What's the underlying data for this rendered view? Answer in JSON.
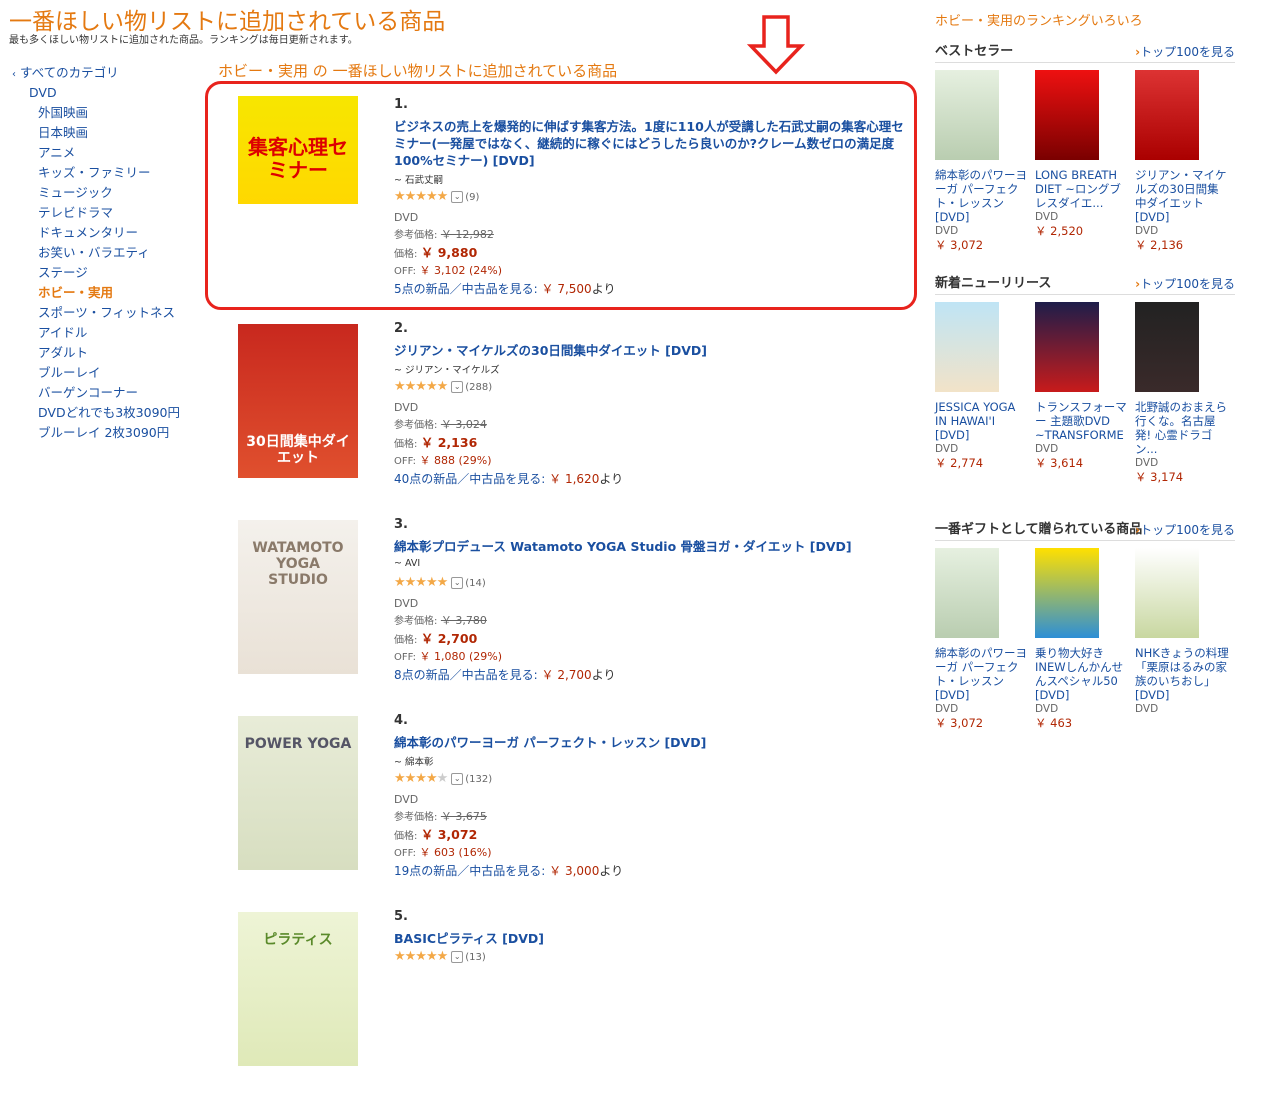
{
  "page": {
    "title": "一番ほしい物リストに追加されている商品",
    "subtitle": "最も多くほしい物リストに追加された商品。ランキングは毎日更新されます。"
  },
  "nav": {
    "all": "すべてのカテゴリ",
    "parent": "DVD",
    "items": [
      "外国映画",
      "日本映画",
      "アニメ",
      "キッズ・ファミリー",
      "ミュージック",
      "テレビドラマ",
      "ドキュメンタリー",
      "お笑い・バラエティ",
      "ステージ",
      "ホビー・実用",
      "スポーツ・フィットネス",
      "アイドル",
      "アダルト",
      "ブルーレイ",
      "バーゲンコーナー",
      "DVDどれでも3枚3090円",
      "ブルーレイ 2枚3090円"
    ],
    "active": "ホビー・実用"
  },
  "list": {
    "heading_category": "ホビー・実用",
    "heading_rest": "の 一番ほしい物リストに追加されている商品",
    "labels": {
      "list_price": "参考価格:",
      "price": "価格:",
      "off": "OFF:",
      "format": "DVD"
    },
    "products": [
      {
        "rank": "1.",
        "title": "ビジネスの売上を爆発的に伸ばす集客方法。1度に110人が受講した石武丈嗣の集客心理セミナー(一発屋ではなく、継続的に稼ぐにはどうしたら良いのか?クレーム数ゼロの満足度100%セミナー) [DVD]",
        "author": "~ 石武丈嗣",
        "rating": 4.5,
        "reviews": "(9)",
        "list_price": "￥ 12,982",
        "price": "￥ 9,880",
        "off": "￥ 3,102 (24%)",
        "offers_prefix": "5点の新品／中古品を見る:",
        "offers_price": "￥ 7,500",
        "offers_suffix": "より",
        "image_text": "集客心理セミナー"
      },
      {
        "rank": "2.",
        "title": "ジリアン・マイケルズの30日間集中ダイエット [DVD]",
        "author": "~ ジリアン・マイケルズ",
        "rating": 4.5,
        "reviews": "(288)",
        "list_price": "￥ 3,024",
        "price": "￥ 2,136",
        "off": "￥ 888 (29%)",
        "offers_prefix": "40点の新品／中古品を見る:",
        "offers_price": "￥ 1,620",
        "offers_suffix": "より",
        "image_text": "30日間集中ダイエット"
      },
      {
        "rank": "3.",
        "title": "綿本彰プロデュース Watamoto YOGA Studio 骨盤ヨガ・ダイエット [DVD]",
        "author": "~ AVI",
        "rating": 4.5,
        "reviews": "(14)",
        "list_price": "￥ 3,780",
        "price": "￥ 2,700",
        "off": "￥ 1,080 (29%)",
        "offers_prefix": "8点の新品／中古品を見る:",
        "offers_price": "￥ 2,700",
        "offers_suffix": "より",
        "image_text": "WATAMOTO YOGA STUDIO"
      },
      {
        "rank": "4.",
        "title": "綿本彰のパワーヨーガ パーフェクト・レッスン [DVD]",
        "author": "~ 綿本彰",
        "rating": 4,
        "reviews": "(132)",
        "list_price": "￥ 3,675",
        "price": "￥ 3,072",
        "off": "￥ 603 (16%)",
        "offers_prefix": "19点の新品／中古品を見る:",
        "offers_price": "￥ 3,000",
        "offers_suffix": "より",
        "image_text": "POWER YOGA"
      },
      {
        "rank": "5.",
        "title": "BASICピラティス [DVD]",
        "author": "",
        "rating": 4.5,
        "reviews": "(13)",
        "list_price": "",
        "price": "",
        "off": "",
        "offers_prefix": "",
        "offers_price": "",
        "offers_suffix": "",
        "image_text": "ピラティス"
      }
    ]
  },
  "right": {
    "heading": "ホビー・実用のランキングいろいろ",
    "top100": "トップ100を見る",
    "sections": [
      {
        "title": "ベストセラー",
        "cards": [
          {
            "title": "綿本彰のパワーヨーガ パーフェクト・レッスン [DVD]",
            "format": "DVD",
            "price": "￥ 3,072"
          },
          {
            "title": "LONG BREATH DIET ~ロングブレスダイエ...",
            "format": "DVD",
            "price": "￥ 2,520"
          },
          {
            "title": "ジリアン・マイケルズの30日間集中ダイエット [DVD]",
            "format": "DVD",
            "price": "￥ 2,136"
          }
        ]
      },
      {
        "title": "新着ニューリリース",
        "cards": [
          {
            "title": "JESSICA YOGA IN HAWAI'I [DVD]",
            "format": "DVD",
            "price": "￥ 2,774"
          },
          {
            "title": "トランスフォーマー 主題歌DVD ~TRANSFORME",
            "format": "DVD",
            "price": "￥ 3,614"
          },
          {
            "title": "北野誠のおまえら行くな。名古屋発! 心霊ドラゴン...",
            "format": "DVD",
            "price": "￥ 3,174"
          }
        ]
      },
      {
        "title": "一番ギフトとして贈られている商品",
        "cards": [
          {
            "title": "綿本彰のパワーヨーガ パーフェクト・レッスン [DVD]",
            "format": "DVD",
            "price": "￥ 3,072"
          },
          {
            "title": "乗り物大好きINEWしんかんせんスペシャル50 [DVD]",
            "format": "DVD",
            "price": "￥ 463"
          },
          {
            "title": "NHKきょうの料理「栗原はるみの家族のいちおし」 [DVD]",
            "format": "DVD",
            "price": ""
          }
        ]
      }
    ]
  },
  "colors": {
    "accent": "#e47911",
    "link": "#1a4fa0",
    "price": "#b12704",
    "highlight": "#e8231d",
    "star": "#f3a847"
  }
}
